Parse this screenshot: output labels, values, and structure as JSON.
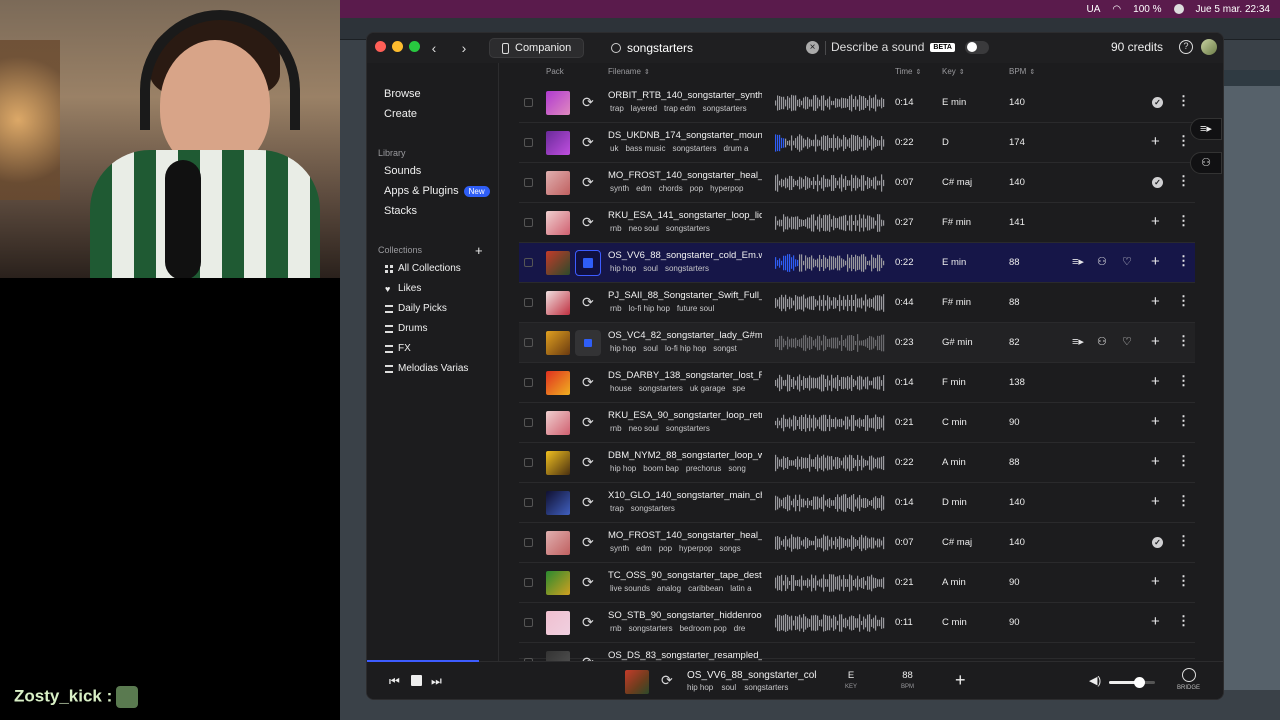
{
  "menubar": {
    "battery": "100 %",
    "datetime": "Jue 5 mar. 22:34",
    "lang": "UA"
  },
  "stream": {
    "name": "Zosty_kick :"
  },
  "titlebar": {
    "companion_label": "Companion",
    "search_value": "songstarters",
    "describe_label": "Describe a sound",
    "beta_label": "BETA",
    "credits": "90 credits"
  },
  "sidebar": {
    "browse": "Browse",
    "create": "Create",
    "library_head": "Library",
    "sounds": "Sounds",
    "apps_plugins": "Apps & Plugins",
    "new_badge": "New",
    "stacks": "Stacks",
    "collections_head": "Collections",
    "collections": [
      {
        "label": "All Collections",
        "icon": "grid-icon"
      },
      {
        "label": "Likes",
        "icon": "heart-icon"
      },
      {
        "label": "Daily Picks",
        "icon": "stack-icon"
      },
      {
        "label": "Drums",
        "icon": "stack-icon"
      },
      {
        "label": "FX",
        "icon": "stack-icon"
      },
      {
        "label": "Melodias Varias",
        "icon": "stack-icon"
      }
    ]
  },
  "table": {
    "headers": {
      "pack": "Pack",
      "filename": "Filename",
      "time": "Time",
      "key": "Key",
      "bpm": "BPM"
    },
    "rows": [
      {
        "filename": "ORBIT_RTB_140_songstarter_synth_",
        "tags": [
          "trap",
          "layered",
          "trap edm",
          "songstarters"
        ],
        "time": "0:14",
        "key": "E min",
        "bpm": "140",
        "status": "check",
        "thumb": "#b03ad0,#e08ac0"
      },
      {
        "filename": "DS_UKDNB_174_songstarter_mount",
        "tags": [
          "uk",
          "bass music",
          "songstarters",
          "drum a"
        ],
        "time": "0:22",
        "key": "D",
        "bpm": "174",
        "status": "plus",
        "thumb": "#6a2a9a,#c04fe0"
      },
      {
        "filename": "MO_FROST_140_songstarter_heal_c",
        "tags": [
          "synth",
          "edm",
          "chords",
          "pop",
          "hyperpop"
        ],
        "time": "0:07",
        "key": "C# maj",
        "bpm": "140",
        "status": "check",
        "thumb": "#e0b0b0,#c06060"
      },
      {
        "filename": "RKU_ESA_141_songstarter_loop_liqu",
        "tags": [
          "rnb",
          "neo soul",
          "songstarters"
        ],
        "time": "0:27",
        "key": "F# min",
        "bpm": "141",
        "status": "plus",
        "thumb": "#f0d0d0,#d06070"
      },
      {
        "filename": "OS_VV6_88_songstarter_cold_Em.w",
        "tags": [
          "hip hop",
          "soul",
          "songstarters"
        ],
        "time": "0:22",
        "key": "E min",
        "bpm": "88",
        "status": "active",
        "thumb": "#c43b2a,#2c4a2a"
      },
      {
        "filename": "PJ_SAII_88_Songstarter_Swift_Full_F",
        "tags": [
          "rnb",
          "lo-fi hip hop",
          "future soul"
        ],
        "time": "0:44",
        "key": "F# min",
        "bpm": "88",
        "status": "plus",
        "thumb": "#f0e0e0,#c03040"
      },
      {
        "filename": "OS_VC4_82_songstarter_lady_G#m.",
        "tags": [
          "hip hop",
          "soul",
          "lo-fi hip hop",
          "songst"
        ],
        "time": "0:23",
        "key": "G# min",
        "bpm": "82",
        "status": "hover",
        "thumb": "#e0a020,#6a3a10"
      },
      {
        "filename": "DS_DARBY_138_songstarter_lost_Fr",
        "tags": [
          "house",
          "songstarters",
          "uk garage",
          "spe"
        ],
        "time": "0:14",
        "key": "F min",
        "bpm": "138",
        "status": "plus",
        "thumb": "#e03020,#f0b020"
      },
      {
        "filename": "RKU_ESA_90_songstarter_loop_retr",
        "tags": [
          "rnb",
          "neo soul",
          "songstarters"
        ],
        "time": "0:21",
        "key": "C min",
        "bpm": "90",
        "status": "plus",
        "thumb": "#f0d0d0,#d06070"
      },
      {
        "filename": "DBM_NYM2_88_songstarter_loop_w",
        "tags": [
          "hip hop",
          "boom bap",
          "prechorus",
          "song"
        ],
        "time": "0:22",
        "key": "A min",
        "bpm": "88",
        "status": "plus",
        "thumb": "#f0c020,#4a3010"
      },
      {
        "filename": "X10_GLO_140_songstarter_main_chi",
        "tags": [
          "trap",
          "songstarters"
        ],
        "time": "0:14",
        "key": "D min",
        "bpm": "140",
        "status": "plus",
        "thumb": "#101030,#4060c0"
      },
      {
        "filename": "MO_FROST_140_songstarter_heal_s",
        "tags": [
          "synth",
          "edm",
          "pop",
          "hyperpop",
          "songs"
        ],
        "time": "0:07",
        "key": "C# maj",
        "bpm": "140",
        "status": "check",
        "thumb": "#e0b0b0,#c06060"
      },
      {
        "filename": "TC_OSS_90_songstarter_tape_desti",
        "tags": [
          "live sounds",
          "analog",
          "caribbean",
          "latin a"
        ],
        "time": "0:21",
        "key": "A min",
        "bpm": "90",
        "status": "plus",
        "thumb": "#2a8a30,#d0a020"
      },
      {
        "filename": "SO_STB_90_songstarter_hiddenroo",
        "tags": [
          "rnb",
          "songstarters",
          "bedroom pop",
          "dre"
        ],
        "time": "0:11",
        "key": "C min",
        "bpm": "90",
        "status": "plus",
        "thumb": "#f0c0d0,#f0d0e0"
      },
      {
        "filename": "OS_DS_83_songstarter_resampled_",
        "tags": [],
        "time": "",
        "key": "",
        "bpm": "",
        "status": "partial",
        "thumb": "#333,#555"
      }
    ]
  },
  "player": {
    "filename": "OS_VV6_88_songstarter_cold",
    "tags": [
      "hip hop",
      "soul",
      "songstarters"
    ],
    "key_value": "E",
    "key_label": "KEY",
    "bpm_value": "88",
    "bpm_label": "BPM",
    "bridge_label": "BRIDGE",
    "volume": 0.65
  },
  "colors": {
    "accent": "#2f5ef6",
    "active_row": "#161648",
    "background": "#1c1c1e"
  }
}
